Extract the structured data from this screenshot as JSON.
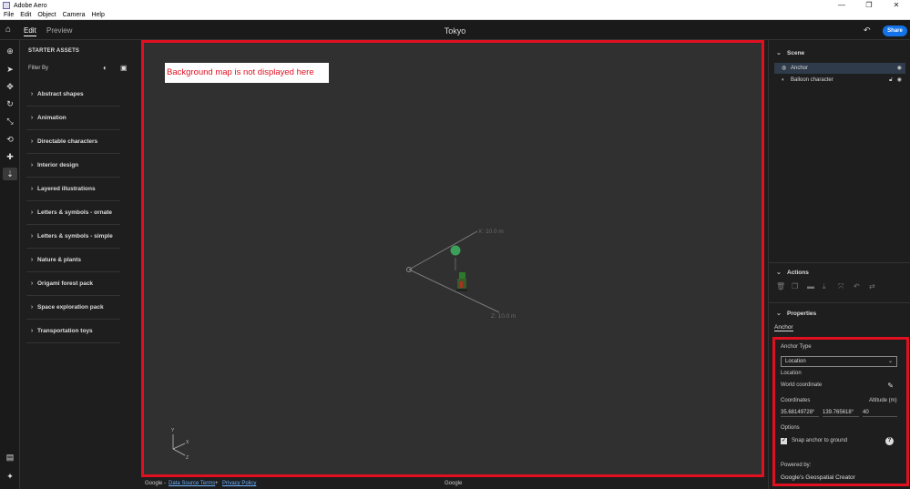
{
  "window": {
    "title": "Adobe Aero",
    "minimize": "—",
    "maximize": "❐",
    "close": "✕"
  },
  "menu": [
    "File",
    "Edit",
    "Object",
    "Camera",
    "Help"
  ],
  "topbar": {
    "tabs": [
      {
        "label": "Edit",
        "active": true
      },
      {
        "label": "Preview",
        "active": false
      }
    ],
    "doc_title": "Tokyo",
    "share_label": "Share"
  },
  "tools": [
    {
      "name": "add-icon",
      "glyph": "⊕"
    },
    {
      "name": "select-icon",
      "glyph": "➤"
    },
    {
      "name": "move-icon",
      "glyph": "✥"
    },
    {
      "name": "rotate-icon",
      "glyph": "↻"
    },
    {
      "name": "scale-icon",
      "glyph": "⤡"
    },
    {
      "name": "orbit-icon",
      "glyph": "⟲"
    },
    {
      "name": "pan-icon",
      "glyph": "✚"
    },
    {
      "name": "place-icon",
      "glyph": "⇣"
    }
  ],
  "assets": {
    "header": "STARTER ASSETS",
    "filter_label": "Filter By",
    "categories": [
      "Abstract shapes",
      "Animation",
      "Directable characters",
      "Interior design",
      "Layered illustrations",
      "Letters & symbols - ornate",
      "Letters & symbols - simple",
      "Nature & plants",
      "Origami forest pack",
      "Space exploration pack",
      "Transportation toys"
    ]
  },
  "viewport": {
    "note": "Background map is not displayed here",
    "axis_x_label": "X: 10.0 m",
    "axis_z_label": "Z: 10.0 m",
    "gizmo_y": "Y",
    "gizmo_x": "X",
    "gizmo_z": "Z"
  },
  "footer": {
    "google_prefix": "Google -",
    "data_source_link": "Data Source Terms",
    "separator": "+",
    "privacy_link": "Privacy Policy",
    "google_center": "Google"
  },
  "scene": {
    "title": "Scene",
    "items": [
      {
        "label": "Anchor",
        "selected": true
      },
      {
        "label": "Balloon character",
        "selected": false
      }
    ]
  },
  "actions": {
    "title": "Actions",
    "icons": [
      "trash-icon",
      "duplicate-icon",
      "group-icon",
      "download-icon",
      "expand-icon",
      "undo-icon",
      "replace-icon"
    ]
  },
  "properties": {
    "title": "Properties",
    "active_tab": "Anchor",
    "anchor_type_label": "Anchor Type",
    "anchor_type_value": "Location",
    "location_label": "Location",
    "world_coordinate_label": "World coordinate",
    "coordinates_label": "Coordinates",
    "altitude_label": "Altitude (m)",
    "latitude": "35.68149728°",
    "longitude": "139.765618°",
    "altitude": "40",
    "options_label": "Options",
    "snap_label": "Snap anchor to ground",
    "snap_checked": true,
    "powered_by_label": "Powered by:",
    "powered_by_value": "Google's Geospatial Creator"
  }
}
